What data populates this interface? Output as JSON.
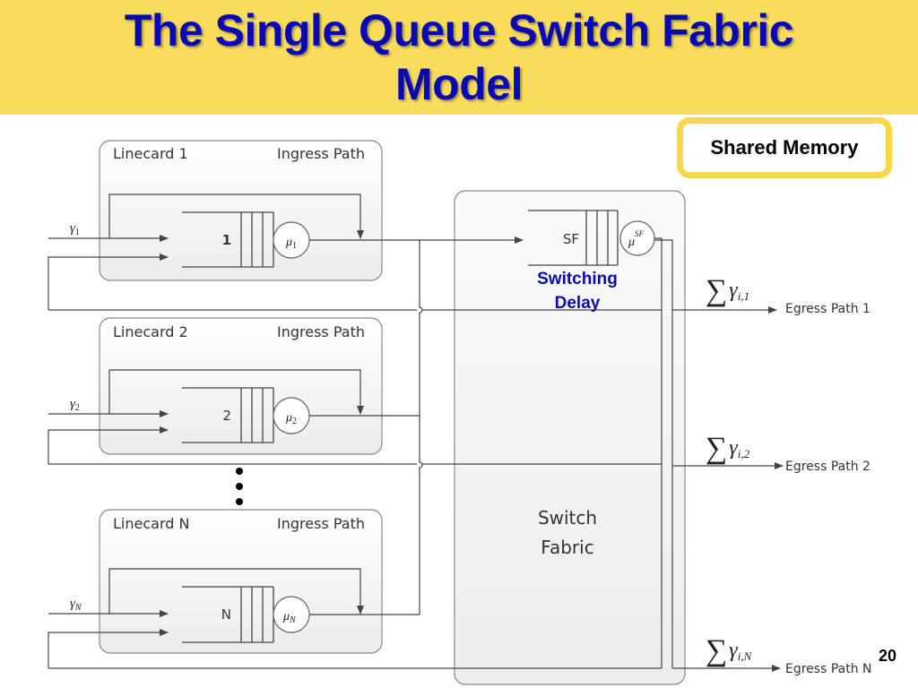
{
  "slide": {
    "title_line1": "The Single Queue Switch Fabric",
    "title_line2": "Model",
    "callout": "Shared Memory",
    "page_number": "20"
  },
  "colors": {
    "title_bar": "#f9dc5c",
    "title_text": "#0a0ab4",
    "callout_border": "#f6d84a",
    "annotation_text": "#0a0ab4"
  },
  "linecards": [
    {
      "name": "Linecard 1",
      "path": "Ingress Path",
      "queue_label": "1",
      "arrival": "γ",
      "arrival_sub": "1",
      "service": "μ",
      "service_sub": "1"
    },
    {
      "name": "Linecard 2",
      "path": "Ingress Path",
      "queue_label": "2",
      "arrival": "γ",
      "arrival_sub": "2",
      "service": "μ",
      "service_sub": "2"
    },
    {
      "name": "Linecard N",
      "path": "Ingress Path",
      "queue_label": "N",
      "arrival": "γ",
      "arrival_sub": "N",
      "service": "μ",
      "service_sub": "N"
    }
  ],
  "ellipsis_dots": 3,
  "switch_fabric": {
    "label_line1": "Switch",
    "label_line2": "Fabric",
    "queue_label": "SF",
    "service": "μ",
    "service_sup": "SF",
    "annotation_line1": "Switching",
    "annotation_line2": "Delay"
  },
  "egress": [
    {
      "sum": "∑",
      "gamma": "γ",
      "sub": "i,1",
      "label": "Egress Path 1"
    },
    {
      "sum": "∑",
      "gamma": "γ",
      "sub": "i,2",
      "label": "Egress Path 2"
    },
    {
      "sum": "∑",
      "gamma": "γ",
      "sub": "i,N",
      "label": "Egress Path N"
    }
  ]
}
